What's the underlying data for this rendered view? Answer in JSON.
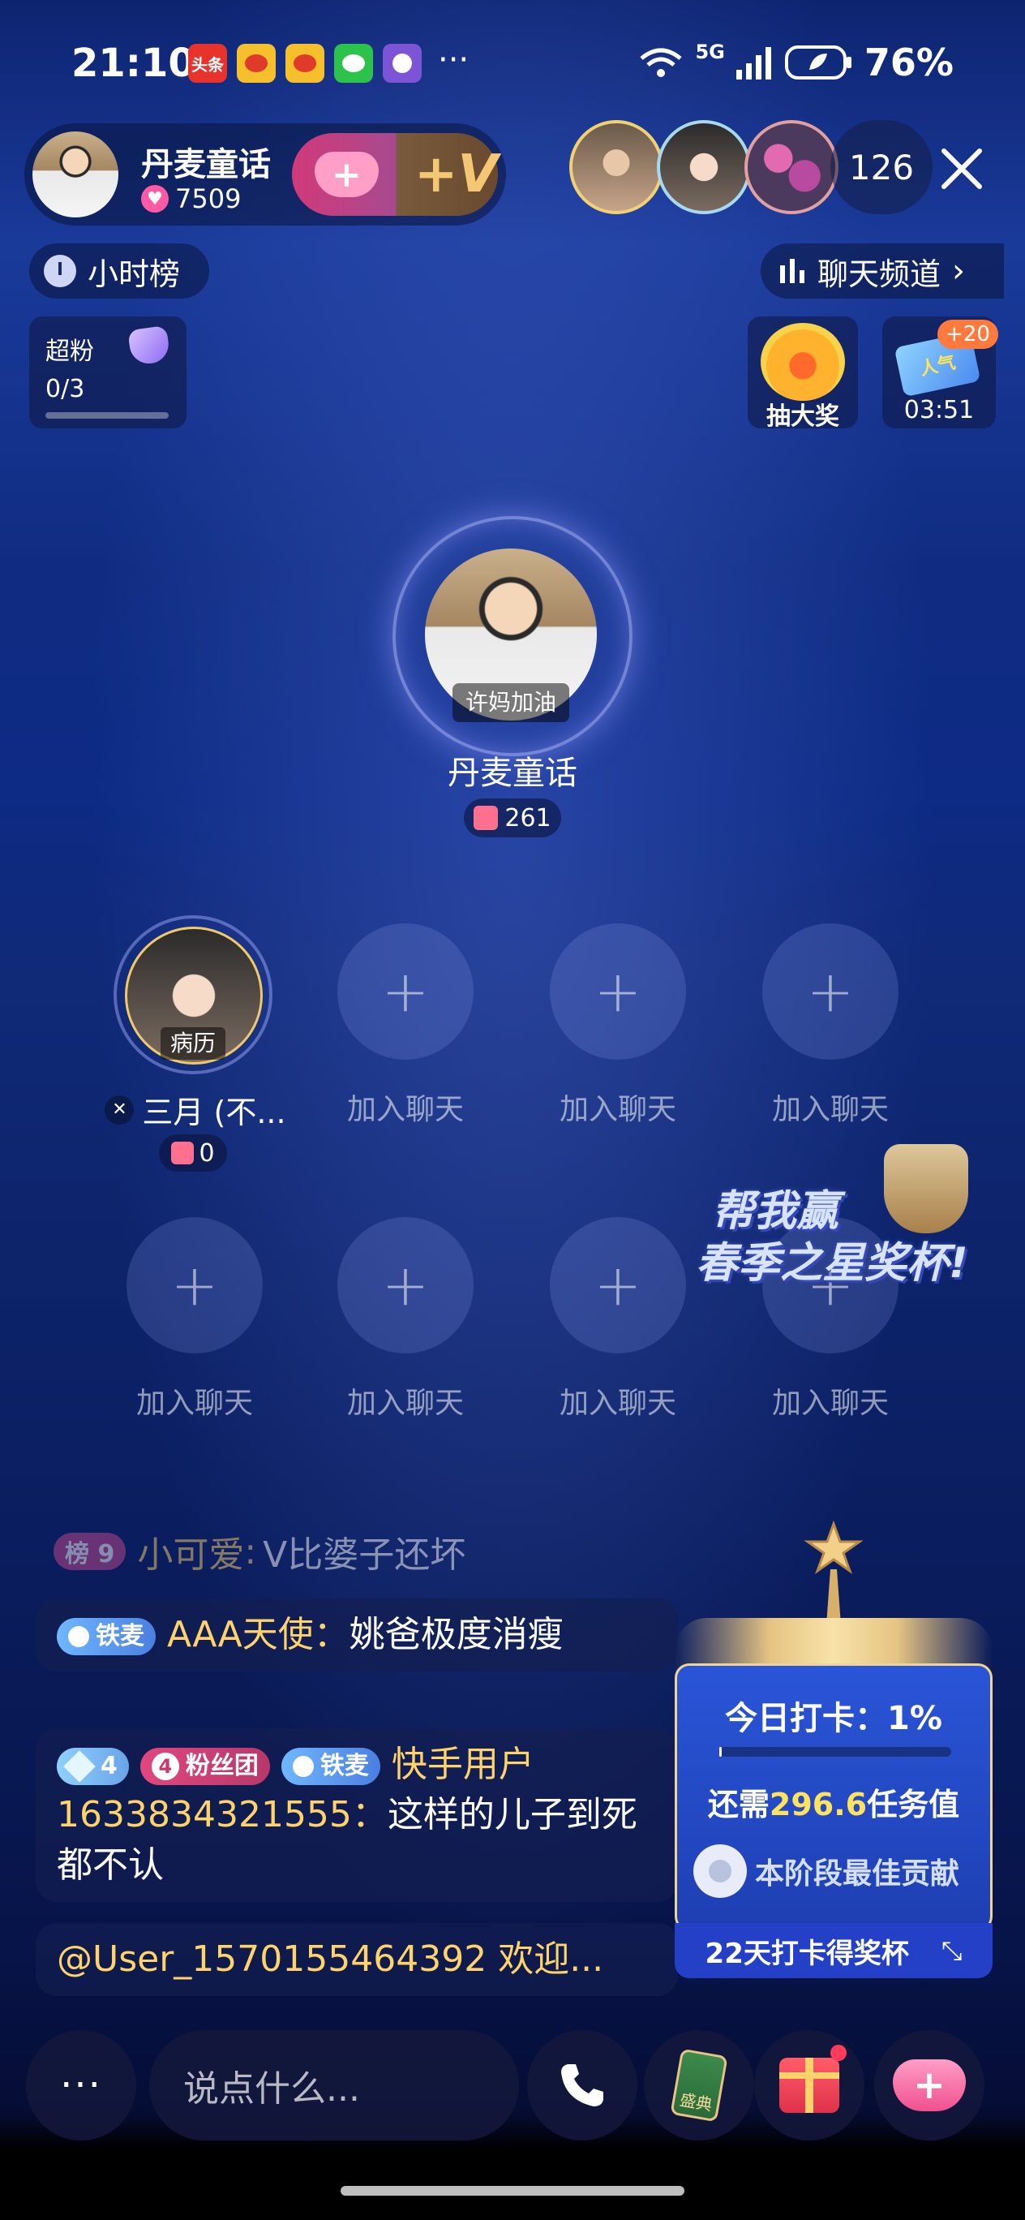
{
  "status_bar": {
    "time": "21:10",
    "battery": "76%",
    "net": "5G",
    "notif_icons": [
      "toutiao-icon",
      "weibo-icon",
      "weibo-icon",
      "wechat-icon",
      "game-icon"
    ],
    "more": "···"
  },
  "host": {
    "name": "丹麦童话",
    "likes": "7509"
  },
  "viewers": {
    "count": "126"
  },
  "hour_rank": "小时榜",
  "chat_channel": "聊天频道",
  "superfan": {
    "label": "超粉",
    "progress": "0/3",
    "progress_fraction": 0
  },
  "lottery": {
    "label": "抽大奖"
  },
  "popularity": {
    "badge": "+20",
    "timer": "03:51",
    "icon_text": "人气"
  },
  "main_seat": {
    "tag": "许妈加油",
    "name": "丹麦童话",
    "gifts": "261"
  },
  "seats": {
    "occupied": {
      "tag": "病历",
      "name": "三月 (不...",
      "gifts": "0"
    },
    "empty_label": "加入聊天"
  },
  "promo": {
    "line1": "帮我赢",
    "line2": "春季之星奖杯!"
  },
  "chat": {
    "faded": {
      "rank": "榜 9",
      "user": "小可爱",
      "msg": "V比婆子还坏"
    },
    "msg1": {
      "badge": "铁麦",
      "user": "AAA天使",
      "msg": "姚爸极度消瘦"
    },
    "msg2": {
      "diamond": "4",
      "fan_level": "4",
      "fan_label": "粉丝团",
      "badge": "铁麦",
      "user": "快手用户1633834321555",
      "msg": "这样的儿子到死都不认"
    },
    "msg3": {
      "text": "@User_1570155464392 欢迎..."
    }
  },
  "checkin": {
    "title": "今日打卡：1%",
    "progress_fraction": 0.01,
    "need_prefix": "还需",
    "need_value": "296.6",
    "need_suffix": "任务值",
    "best": "本阶段最佳贡献",
    "footer": "22天打卡得奖杯"
  },
  "bottom_bar": {
    "more": "···",
    "input_placeholder": "说点什么...",
    "draw_label": "盛典"
  }
}
